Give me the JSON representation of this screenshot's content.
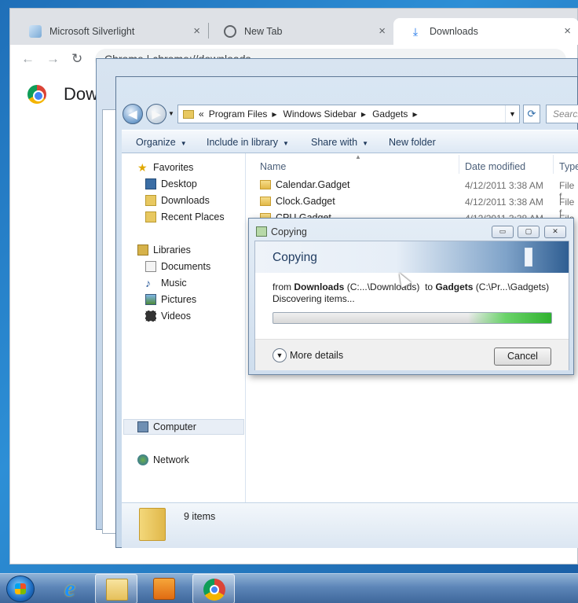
{
  "chrome": {
    "tabs": [
      {
        "label": "Microsoft Silverlight",
        "close": "×"
      },
      {
        "label": "New Tab",
        "close": "×"
      },
      {
        "label": "Downloads",
        "close": "×"
      }
    ],
    "nav": {
      "back": "←",
      "forward": "→",
      "reload": "↻"
    },
    "omnibox": "Chrome  |  chrome://downloads",
    "page_title": "Downloads"
  },
  "explorer": {
    "address": {
      "overflow": "«",
      "crumbs": [
        "Program Files",
        "Windows Sidebar",
        "Gadgets"
      ]
    },
    "search_placeholder": "Search",
    "commands": {
      "organize": "Organize",
      "include_in_library": "Include in library",
      "share_with": "Share with",
      "new_folder": "New folder"
    },
    "nav_pane": {
      "favorites": "Favorites",
      "desktop": "Desktop",
      "downloads": "Downloads",
      "recent_places": "Recent Places",
      "libraries": "Libraries",
      "documents": "Documents",
      "music": "Music",
      "pictures": "Pictures",
      "videos": "Videos",
      "computer": "Computer",
      "network": "Network"
    },
    "columns": {
      "name": "Name",
      "date_modified": "Date modified",
      "type": "Type"
    },
    "files": [
      {
        "name": "Calendar.Gadget",
        "date": "4/12/2011 3:38 AM",
        "type": "File f"
      },
      {
        "name": "Clock.Gadget",
        "date": "4/12/2011 3:38 AM",
        "type": "File f"
      },
      {
        "name": "CPU.Gadget",
        "date": "4/12/2011 3:38 AM",
        "type": "File f"
      }
    ],
    "items_count": "9 items"
  },
  "copy_dialog": {
    "title": "Copying",
    "heading": "Copying",
    "from_label": "from",
    "source_name": "Downloads",
    "source_path": "(C:...\\Downloads)",
    "to_label": "to",
    "dest_name": "Gadgets",
    "dest_path": "(C:\\Pr...\\Gadgets)",
    "status": "Discovering items...",
    "more_details": "More details",
    "cancel": "Cancel",
    "window_buttons": {
      "minimize": "▭",
      "maximize": "▢",
      "close": "✕"
    }
  },
  "colors": {
    "accent": "#1a73e8",
    "aero_glass": "#c5d7ea",
    "progress_green": "#2fb22f",
    "taskbar": "#5d86b8"
  },
  "taskbar": {
    "icons": [
      "start-orb-icon",
      "internet-explorer-icon",
      "windows-explorer-icon",
      "media-center-icon",
      "chrome-icon"
    ]
  }
}
